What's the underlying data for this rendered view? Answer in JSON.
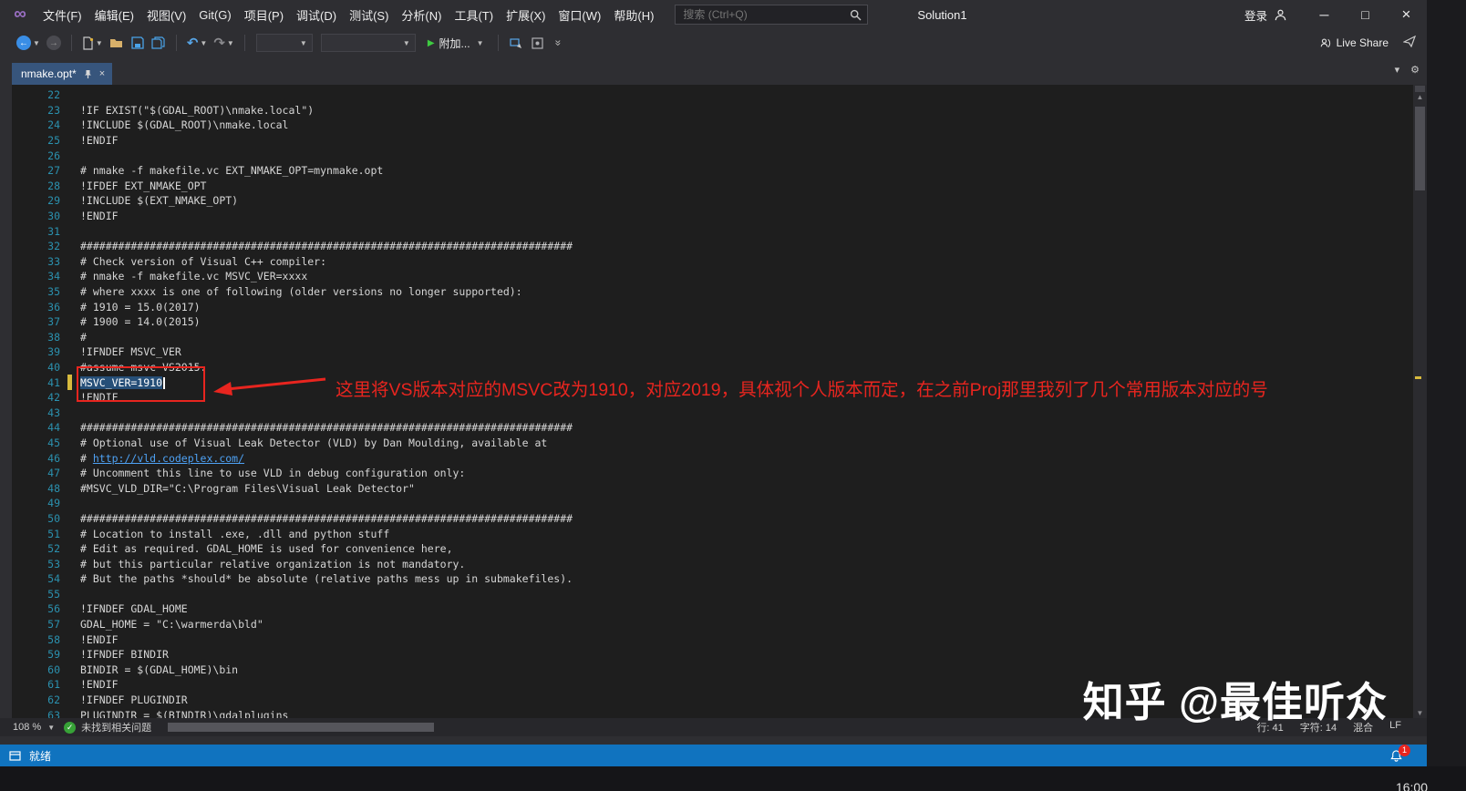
{
  "colors": {
    "accent": "#1073bf",
    "editor_bg": "#1e1e1e",
    "line_number": "#2b91af",
    "selection": "#264f78",
    "annotation_red": "#e8251f",
    "link": "#4ea1f3",
    "tab_active_bg": "#37557c",
    "change_yellow": "#d7ba3d",
    "health_green": "#37a237",
    "badge_red": "#e8251f"
  },
  "titlebar": {
    "menus": [
      "文件(F)",
      "编辑(E)",
      "视图(V)",
      "Git(G)",
      "项目(P)",
      "调试(D)",
      "测试(S)",
      "分析(N)",
      "工具(T)",
      "扩展(X)",
      "窗口(W)",
      "帮助(H)"
    ],
    "search_placeholder": "搜索 (Ctrl+Q)",
    "solution_name": "Solution1",
    "sign_in": "登录"
  },
  "toolbar": {
    "attach_label": "附加...",
    "live_share_label": "Live Share"
  },
  "tabbar": {
    "active_tab": "nmake.opt*"
  },
  "editor": {
    "lines": [
      {
        "n": 22,
        "t": ""
      },
      {
        "n": 23,
        "t": "!IF EXIST(\"$(GDAL_ROOT)\\nmake.local\")"
      },
      {
        "n": 24,
        "t": "!INCLUDE $(GDAL_ROOT)\\nmake.local"
      },
      {
        "n": 25,
        "t": "!ENDIF"
      },
      {
        "n": 26,
        "t": ""
      },
      {
        "n": 27,
        "t": "# nmake -f makefile.vc EXT_NMAKE_OPT=mynmake.opt"
      },
      {
        "n": 28,
        "t": "!IFDEF EXT_NMAKE_OPT"
      },
      {
        "n": 29,
        "t": "!INCLUDE $(EXT_NMAKE_OPT)"
      },
      {
        "n": 30,
        "t": "!ENDIF"
      },
      {
        "n": 31,
        "t": ""
      },
      {
        "n": 32,
        "t": "##############################################################################"
      },
      {
        "n": 33,
        "t": "# Check version of Visual C++ compiler:"
      },
      {
        "n": 34,
        "t": "# nmake -f makefile.vc MSVC_VER=xxxx"
      },
      {
        "n": 35,
        "t": "# where xxxx is one of following (older versions no longer supported):"
      },
      {
        "n": 36,
        "t": "# 1910 = 15.0(2017)"
      },
      {
        "n": 37,
        "t": "# 1900 = 14.0(2015)"
      },
      {
        "n": 38,
        "t": "#"
      },
      {
        "n": 39,
        "t": "!IFNDEF MSVC_VER"
      },
      {
        "n": 40,
        "t": "#assume msvc VS2015."
      },
      {
        "n": 41,
        "t": "MSVC_VER=1910",
        "selected": true,
        "modified": true
      },
      {
        "n": 42,
        "t": "!ENDIF"
      },
      {
        "n": 43,
        "t": ""
      },
      {
        "n": 44,
        "t": "##############################################################################"
      },
      {
        "n": 45,
        "t": "# Optional use of Visual Leak Detector (VLD) by Dan Moulding, available at"
      },
      {
        "n": 46,
        "t": "# ",
        "link": "http://vld.codeplex.com/"
      },
      {
        "n": 47,
        "t": "# Uncomment this line to use VLD in debug configuration only:"
      },
      {
        "n": 48,
        "t": "#MSVC_VLD_DIR=\"C:\\Program Files\\Visual Leak Detector\""
      },
      {
        "n": 49,
        "t": ""
      },
      {
        "n": 50,
        "t": "##############################################################################"
      },
      {
        "n": 51,
        "t": "# Location to install .exe, .dll and python stuff"
      },
      {
        "n": 52,
        "t": "# Edit as required. GDAL_HOME is used for convenience here,"
      },
      {
        "n": 53,
        "t": "# but this particular relative organization is not mandatory."
      },
      {
        "n": 54,
        "t": "# But the paths *should* be absolute (relative paths mess up in submakefiles)."
      },
      {
        "n": 55,
        "t": ""
      },
      {
        "n": 56,
        "t": "!IFNDEF GDAL_HOME"
      },
      {
        "n": 57,
        "t": "GDAL_HOME = \"C:\\warmerda\\bld\""
      },
      {
        "n": 58,
        "t": "!ENDIF"
      },
      {
        "n": 59,
        "t": "!IFNDEF BINDIR"
      },
      {
        "n": 60,
        "t": "BINDIR = $(GDAL_HOME)\\bin"
      },
      {
        "n": 61,
        "t": "!ENDIF"
      },
      {
        "n": 62,
        "t": "!IFNDEF PLUGINDIR"
      },
      {
        "n": 63,
        "t": "PLUGINDIR = $(BINDIR)\\gdalplugins"
      }
    ]
  },
  "annotation": {
    "text": "这里将VS版本对应的MSVC改为1910，对应2019，具体视个人版本而定，在之前Proj那里我列了几个常用版本对应的号"
  },
  "scroll_row": {
    "zoom": "108 %",
    "health_label": "未找到相关问题",
    "line": "行: 41",
    "column": "字符: 14",
    "encoding": "混合",
    "eol": "LF"
  },
  "status_bar": {
    "ready_label": "就绪",
    "notification_count": "1"
  },
  "watermark_text": "知乎 @最佳听众",
  "clock": "16:00"
}
